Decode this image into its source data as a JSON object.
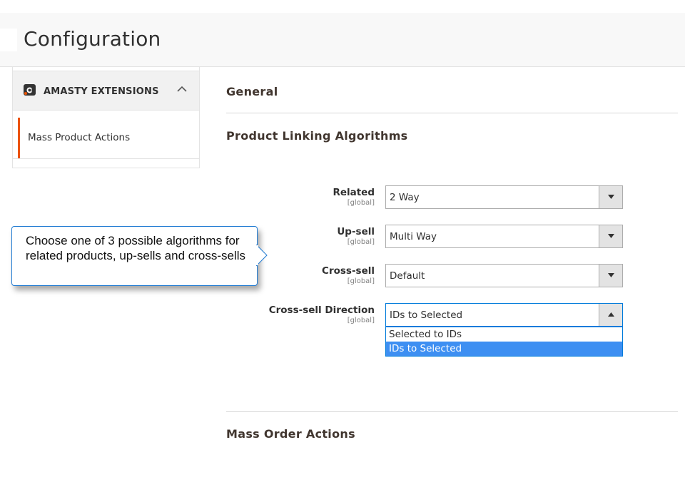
{
  "header": {
    "title": "Configuration"
  },
  "sidebar": {
    "section": {
      "label": "AMASTY EXTENSIONS",
      "icon": "amasty-logo-icon",
      "toggle_icon": "chevron-up-icon"
    },
    "items": [
      {
        "label": "Mass Product Actions",
        "active": true
      }
    ]
  },
  "main": {
    "general_title": "General",
    "linking_title": "Product Linking Algorithms",
    "fields": [
      {
        "label": "Related",
        "scope": "[global]",
        "value": "2 Way"
      },
      {
        "label": "Up-sell",
        "scope": "[global]",
        "value": "Multi Way"
      },
      {
        "label": "Cross-sell",
        "scope": "[global]",
        "value": "Default"
      },
      {
        "label": "Cross-sell Direction",
        "scope": "[global]",
        "value": "IDs to Selected"
      }
    ],
    "dropdown_options": [
      {
        "label": "Selected to IDs",
        "selected": false
      },
      {
        "label": "IDs to Selected",
        "selected": true
      }
    ],
    "mass_order_title": "Mass Order Actions"
  },
  "callout": {
    "text": "Choose one of 3 possible algorithms for related products, up-sells and cross-sells"
  },
  "colors": {
    "accent": "#eb5202",
    "focus": "#007bdb",
    "option_selected": "#3d8ff2",
    "callout_border": "#1f7ad2"
  }
}
